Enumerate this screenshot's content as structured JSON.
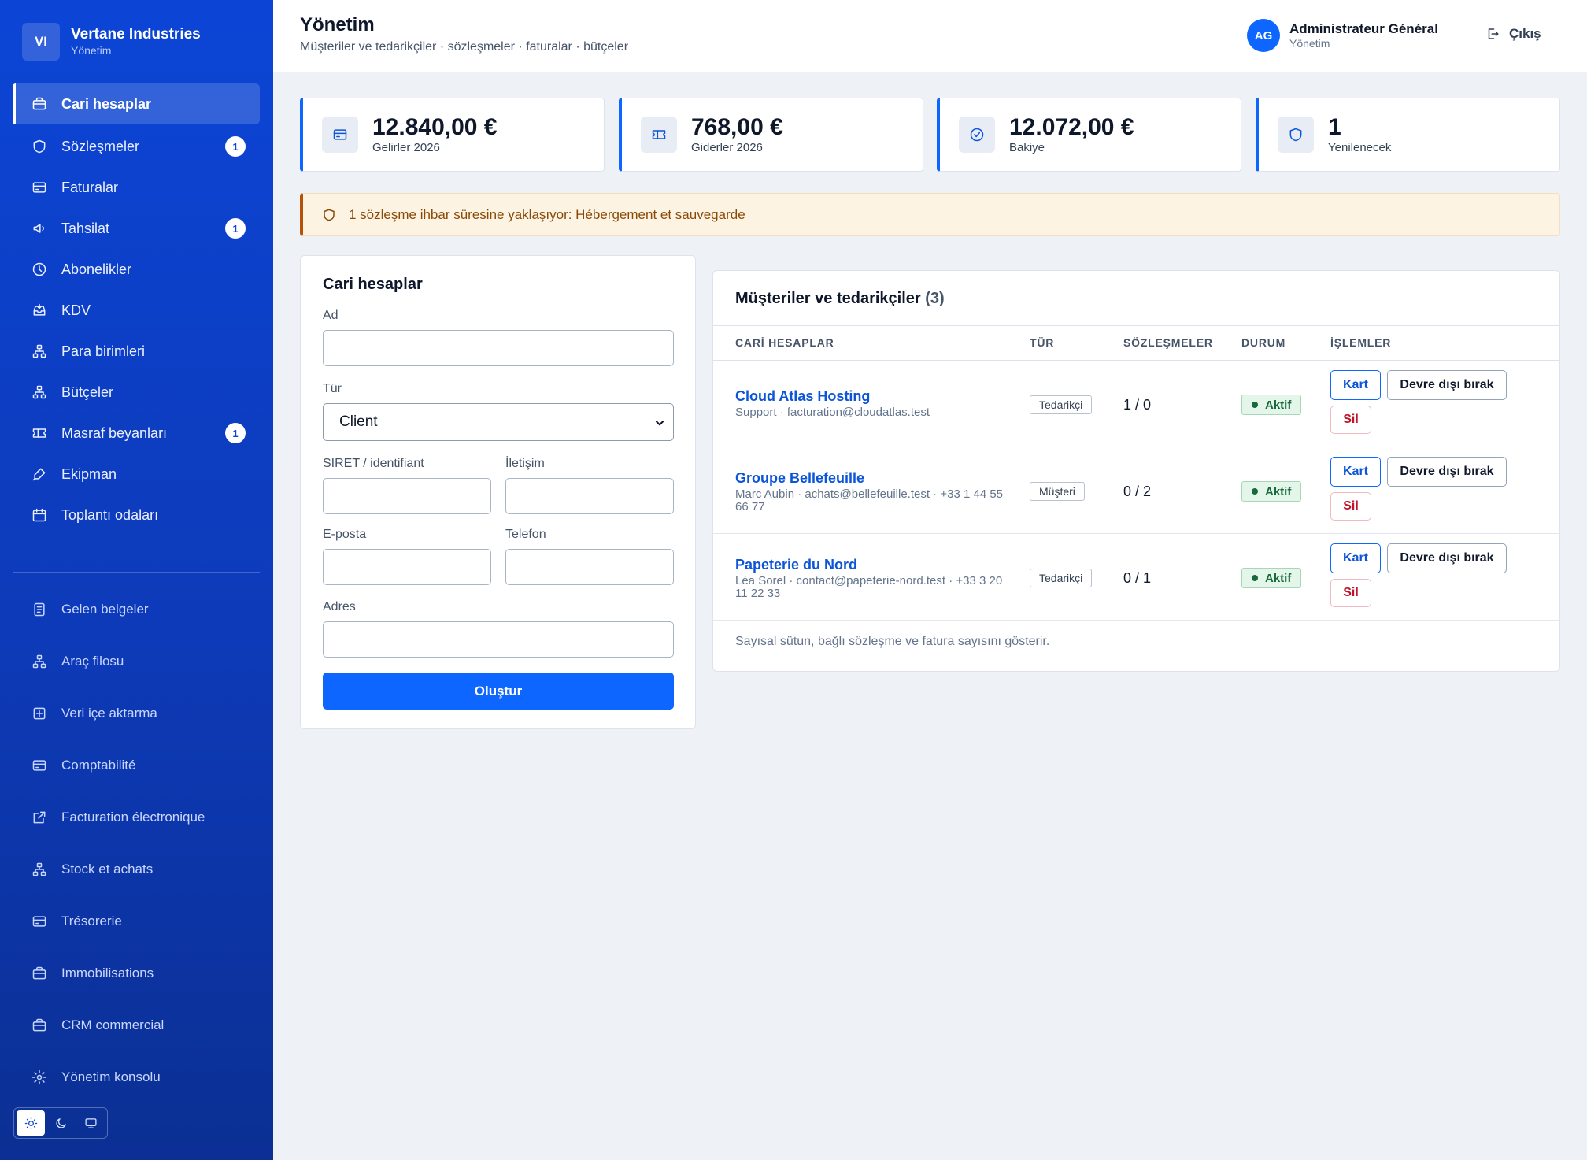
{
  "brand": {
    "initials": "VI",
    "name": "Vertane Industries",
    "sub": "Yönetim"
  },
  "nav_primary": [
    {
      "label": "Cari hesaplar",
      "icon": "briefcase-icon",
      "active": true,
      "badge": ""
    },
    {
      "label": "Sözleşmeler",
      "icon": "shield-icon",
      "active": false,
      "badge": "1"
    },
    {
      "label": "Faturalar",
      "icon": "credit-card-icon",
      "active": false,
      "badge": ""
    },
    {
      "label": "Tahsilat",
      "icon": "megaphone-icon",
      "active": false,
      "badge": "1"
    },
    {
      "label": "Abonelikler",
      "icon": "clock-icon",
      "active": false,
      "badge": ""
    },
    {
      "label": "KDV",
      "icon": "inbox-icon",
      "active": false,
      "badge": ""
    },
    {
      "label": "Para birimleri",
      "icon": "network-icon",
      "active": false,
      "badge": ""
    },
    {
      "label": "Bütçeler",
      "icon": "network-icon",
      "active": false,
      "badge": ""
    },
    {
      "label": "Masraf beyanları",
      "icon": "ticket-icon",
      "active": false,
      "badge": "1"
    },
    {
      "label": "Ekipman",
      "icon": "pen-icon",
      "active": false,
      "badge": ""
    },
    {
      "label": "Toplantı odaları",
      "icon": "calendar-icon",
      "active": false,
      "badge": ""
    }
  ],
  "nav_secondary": [
    {
      "label": "Gelen belgeler",
      "icon": "document-icon"
    },
    {
      "label": "Araç filosu",
      "icon": "network-icon"
    },
    {
      "label": "Veri içe aktarma",
      "icon": "plus-square-icon"
    },
    {
      "label": "Comptabilité",
      "icon": "credit-card-icon"
    },
    {
      "label": "Facturation électronique",
      "icon": "external-link-icon"
    },
    {
      "label": "Stock et achats",
      "icon": "network-icon"
    },
    {
      "label": "Trésorerie",
      "icon": "credit-card-icon"
    },
    {
      "label": "Immobilisations",
      "icon": "briefcase-icon"
    },
    {
      "label": "CRM commercial",
      "icon": "briefcase-icon"
    },
    {
      "label": "Yönetim konsolu",
      "icon": "gear-icon"
    }
  ],
  "theme": {
    "options": [
      "sun-icon",
      "moon-icon",
      "monitor-icon"
    ],
    "selected": "sun-icon"
  },
  "header": {
    "title": "Yönetim",
    "subtitle": "Müşteriler ve tedarikçiler · sözleşmeler · faturalar · bütçeler",
    "user_initials": "AG",
    "user_name": "Administrateur Général",
    "user_role": "Yönetim",
    "logout_label": "Çıkış"
  },
  "stats": [
    {
      "value": "12.840,00 €",
      "label": "Gelirler 2026",
      "icon": "credit-card-icon"
    },
    {
      "value": "768,00 €",
      "label": "Giderler 2026",
      "icon": "ticket-icon"
    },
    {
      "value": "12.072,00 €",
      "label": "Bakiye",
      "icon": "check-circle-icon"
    },
    {
      "value": "1",
      "label": "Yenilenecek",
      "icon": "shield-icon"
    }
  ],
  "alert": {
    "text": "1 sözleşme ihbar süresine yaklaşıyor: Hébergement et sauvegarde",
    "icon": "shield-icon"
  },
  "form": {
    "title": "Cari hesaplar",
    "name_label": "Ad",
    "name_value": "",
    "type_label": "Tür",
    "type_value": "Client",
    "siret_label": "SIRET / identifiant",
    "siret_value": "",
    "contact_label": "İletişim",
    "contact_value": "",
    "email_label": "E-posta",
    "email_value": "",
    "phone_label": "Telefon",
    "phone_value": "",
    "address_label": "Adres",
    "address_value": "",
    "submit_label": "Oluştur"
  },
  "table": {
    "title": "Müşteriler ve tedarikçiler",
    "count": "(3)",
    "columns": [
      "CARİ HESAPLAR",
      "TÜR",
      "SÖZLEŞMELER",
      "DURUM",
      "İŞLEMLER"
    ],
    "rows": [
      {
        "name": "Cloud Atlas Hosting",
        "sub": "Support · facturation@cloudatlas.test",
        "type": "Tedarikçi",
        "contracts": "1 / 0",
        "status": "Aktif"
      },
      {
        "name": "Groupe Bellefeuille",
        "sub": "Marc Aubin · achats@bellefeuille.test · +33 1 44 55 66 77",
        "type": "Müşteri",
        "contracts": "0 / 2",
        "status": "Aktif"
      },
      {
        "name": "Papeterie du Nord",
        "sub": "Léa Sorel · contact@papeterie-nord.test · +33 3 20 11 22 33",
        "type": "Tedarikçi",
        "contracts": "0 / 1",
        "status": "Aktif"
      }
    ],
    "actions": {
      "card": "Kart",
      "deactivate": "Devre dışı bırak",
      "delete": "Sil"
    },
    "note": "Sayısal sütun, bağlı sözleşme ve fatura sayısını gösterir.",
    "colors": {
      "accent": "#0c66ff",
      "active_green": "#176a3a",
      "danger": "#c0142b"
    }
  }
}
